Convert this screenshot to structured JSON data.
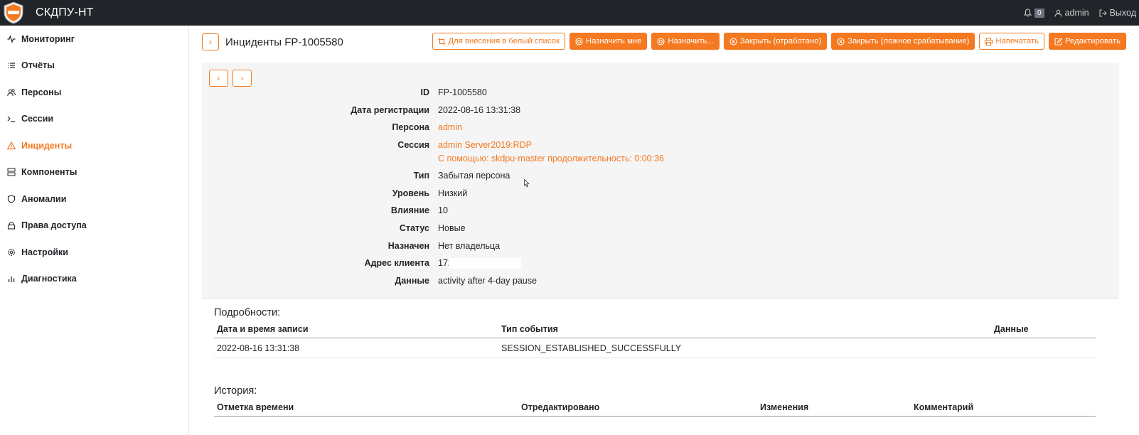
{
  "app": {
    "title": "СКДПУ-НТ"
  },
  "topbar": {
    "notifications_count": "0",
    "user": "admin",
    "logout": "Выход"
  },
  "sidebar": {
    "items": [
      {
        "label": "Мониторинг",
        "icon": "activity-icon"
      },
      {
        "label": "Отчёты",
        "icon": "list-icon"
      },
      {
        "label": "Персоны",
        "icon": "people-icon"
      },
      {
        "label": "Сессии",
        "icon": "terminal-icon"
      },
      {
        "label": "Инциденты",
        "icon": "warning-icon",
        "active": true
      },
      {
        "label": "Компоненты",
        "icon": "server-icon"
      },
      {
        "label": "Аномалии",
        "icon": "shield-icon"
      },
      {
        "label": "Права доступа",
        "icon": "lock-icon"
      },
      {
        "label": "Настройки",
        "icon": "gear-icon"
      },
      {
        "label": "Диагностика",
        "icon": "bar-chart-icon"
      }
    ]
  },
  "page": {
    "title": "Инциденты FP-1005580"
  },
  "actions": {
    "whitelist": "Для внесения в белый список",
    "assign_me": "Назначить мне",
    "assign": "Назначить...",
    "close_done": "Закрыть (отработано)",
    "close_false": "Закрыть (ложное срабатывание)",
    "print": "Напечатать",
    "edit": "Редактировать"
  },
  "details": {
    "id": {
      "label": "ID",
      "value": "FP-1005580"
    },
    "reg_date": {
      "label": "Дата регистрации",
      "value": "2022-08-16 13:31:38"
    },
    "person": {
      "label": "Персона",
      "value": "admin"
    },
    "session": {
      "label": "Сессия",
      "value": "admin Server2019:RDP",
      "value2": "С помощью: skdpu-master продолжительность: 0:00:36"
    },
    "type": {
      "label": "Тип",
      "value": "Забытая персона"
    },
    "level": {
      "label": "Уровень",
      "value": "Низкий"
    },
    "impact": {
      "label": "Влияние",
      "value": "10"
    },
    "status": {
      "label": "Статус",
      "value": "Новые"
    },
    "assigned": {
      "label": "Назначен",
      "value": "Нет владельца"
    },
    "client_addr": {
      "label": "Адрес клиента",
      "value": "172.16."
    },
    "data": {
      "label": "Данные",
      "value": "activity after 4-day pause"
    }
  },
  "events": {
    "title": "Подробности:",
    "columns": [
      "Дата и время записи",
      "Тип события",
      "Данные"
    ],
    "rows": [
      [
        "2022-08-16 13:31:38",
        "SESSION_ESTABLISHED_SUCCESSFULLY",
        ""
      ]
    ]
  },
  "history": {
    "title": "История:",
    "columns": [
      "Отметка времени",
      "Отредактировано",
      "Изменения",
      "Комментарий"
    ]
  },
  "colors": {
    "accent": "#f47920",
    "topbar": "#212529"
  }
}
